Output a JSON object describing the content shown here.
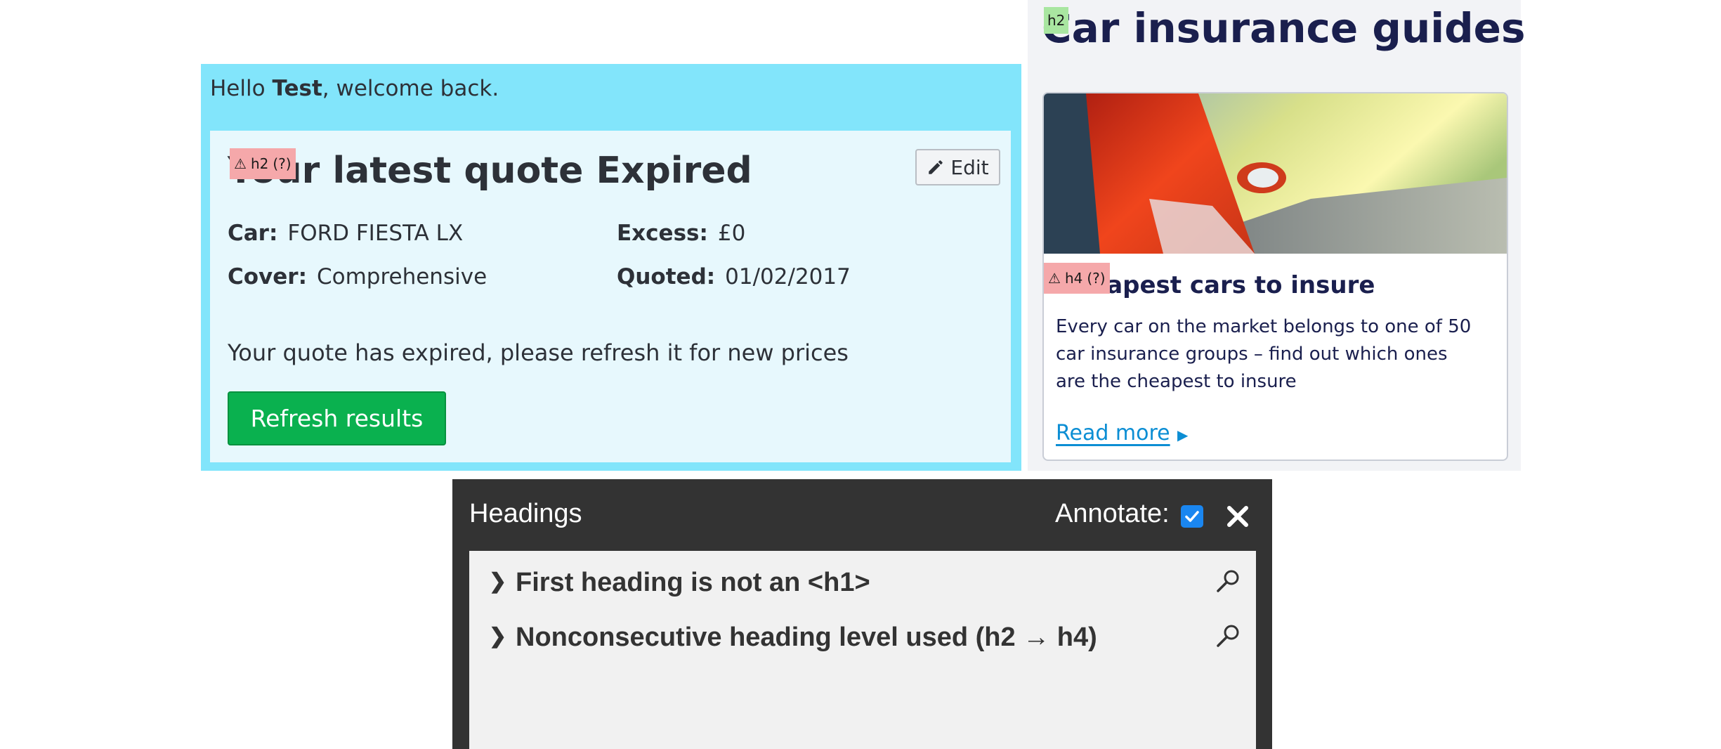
{
  "quote": {
    "greeting_prefix": "Hello ",
    "greeting_name": "Test",
    "greeting_suffix": ", welcome back.",
    "title": "Your latest quote Expired",
    "edit_label": "Edit",
    "details": [
      {
        "key": "Car:",
        "value": "FORD FIESTA LX"
      },
      {
        "key": "Excess:",
        "value": "£0"
      },
      {
        "key": "Cover:",
        "value": "Comprehensive"
      },
      {
        "key": "Quoted:",
        "value": "01/02/2017"
      }
    ],
    "message": "Your quote has expired, please refresh it for new prices",
    "refresh_label": "Refresh results"
  },
  "guides": {
    "title": "Car insurance guides",
    "card": {
      "heading": "Cheapest cars to insure",
      "description": "Every car on the market belongs to one of 50 car insurance groups – find out which ones are the cheapest to insure",
      "read_more": "Read more"
    }
  },
  "annotations": {
    "quote_title_tag": {
      "level": "h2",
      "hint": "(?)",
      "status": "warning"
    },
    "guides_title_tag": {
      "level": "h2",
      "status": "ok"
    },
    "guide_heading_tag": {
      "level": "h4",
      "hint": "(?)",
      "status": "warning"
    },
    "warning_symbol": "⚠"
  },
  "panel": {
    "title": "Headings",
    "annotate_label": "Annotate:",
    "annotate_checked": true,
    "issues": [
      {
        "label": "First heading is not an <h1>"
      },
      {
        "label": "Nonconsecutive heading level used (h2 → h4)"
      }
    ]
  },
  "colors": {
    "quote_outer": "#82e5fb",
    "quote_inner": "#e7f8fd",
    "refresh_button": "#0ab14f",
    "guides_bg": "#f2f3f6",
    "heading_navy": "#1a1f4e",
    "link": "#0c8ed4",
    "panel_bg": "#333333",
    "warning_tag": "#f5a8aa",
    "ok_tag": "#a9e6a1",
    "checkbox": "#1a86f0"
  }
}
